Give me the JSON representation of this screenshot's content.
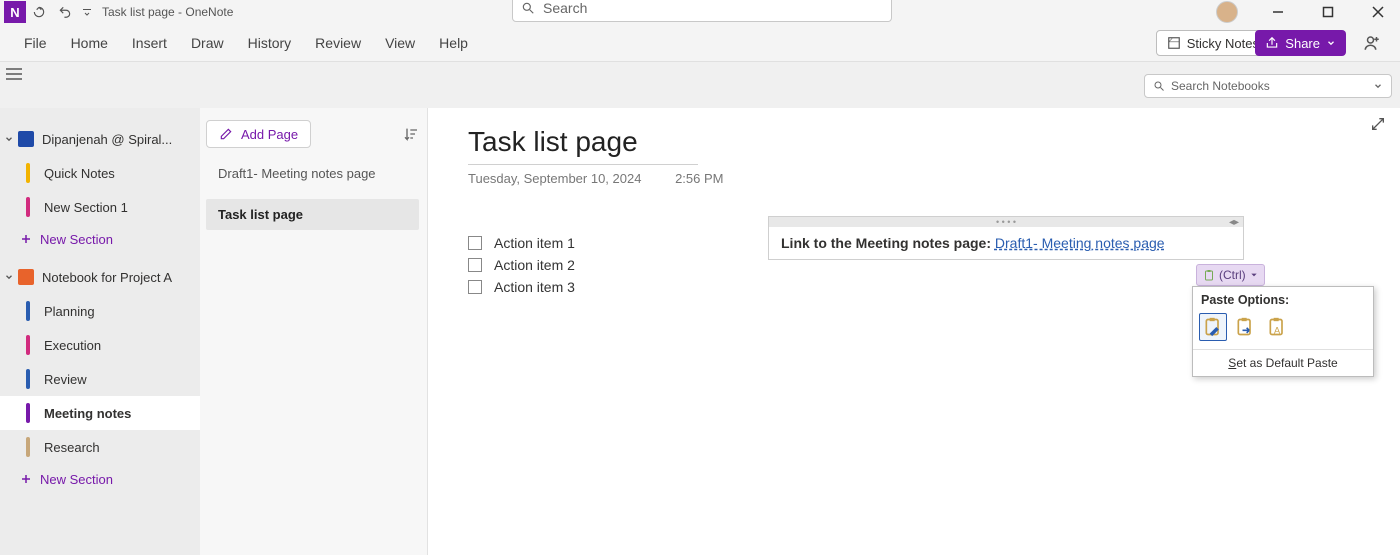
{
  "title": {
    "page": "Task list page",
    "app": "OneNote",
    "sep": " - "
  },
  "titlebar_search_placeholder": "Search",
  "menus": [
    "File",
    "Home",
    "Insert",
    "Draw",
    "History",
    "Review",
    "View",
    "Help"
  ],
  "sticky_label": "Sticky Notes",
  "share_label": "Share",
  "notebook_search_placeholder": "Search Notebooks",
  "notebooks": [
    {
      "name": "Dipanjenah @ Spiral...",
      "color": "#1f4aa8",
      "sections": [
        {
          "label": "Quick Notes",
          "color": "#f2b300"
        },
        {
          "label": "New Section 1",
          "color": "#d12b7e"
        }
      ]
    },
    {
      "name": "Notebook for Project A",
      "color": "#e8632b",
      "sections": [
        {
          "label": "Planning",
          "color": "#2a5db0"
        },
        {
          "label": "Execution",
          "color": "#d12b7e"
        },
        {
          "label": "Review",
          "color": "#2a5db0"
        },
        {
          "label": "Meeting notes",
          "color": "#7719aa",
          "selected": true
        },
        {
          "label": "Research",
          "color": "#c7a77a"
        }
      ]
    }
  ],
  "new_section_label": "New Section",
  "add_page_label": "Add Page",
  "pages": [
    {
      "label": "Draft1- Meeting notes page"
    },
    {
      "label": "Task list page",
      "selected": true
    }
  ],
  "page": {
    "title": "Task list page",
    "date": "Tuesday, September 10, 2024",
    "time": "2:56 PM"
  },
  "todos": [
    "Action item 1",
    "Action item 2",
    "Action item 3"
  ],
  "paste_box": {
    "prefix": "Link to the Meeting notes page: ",
    "link": "Draft1- Meeting notes page"
  },
  "ctrl_label": "(Ctrl)",
  "paste_menu": {
    "title": "Paste Options:",
    "default_prefix": "S",
    "default_rest": "et as Default Paste"
  }
}
